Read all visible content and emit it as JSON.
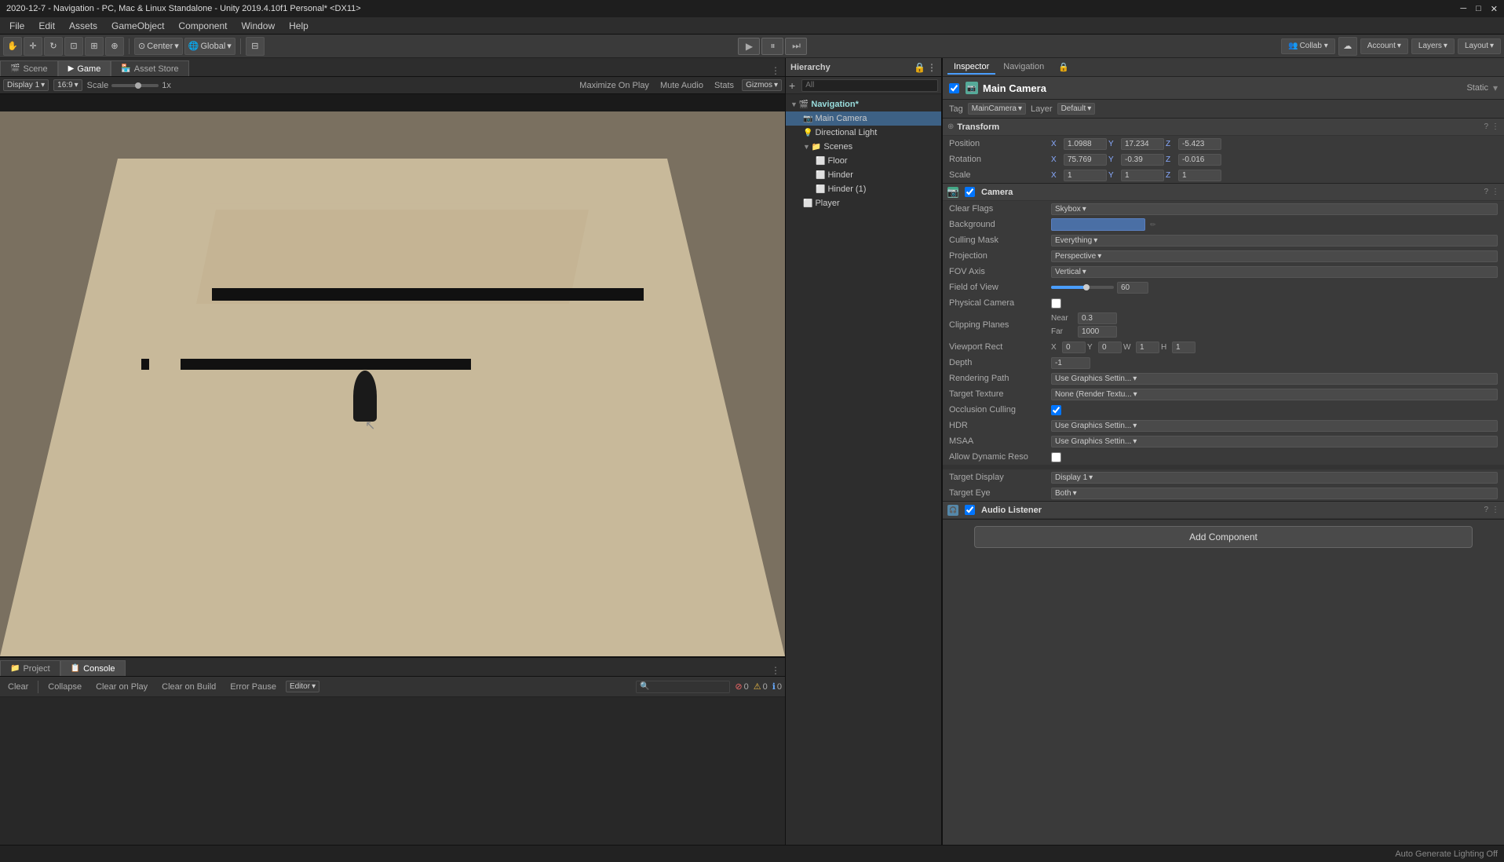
{
  "titlebar": {
    "text": "2020-12-7 - Navigation - PC, Mac & Linux Standalone - Unity 2019.4.10f1 Personal* <DX11>"
  },
  "menubar": {
    "items": [
      "File",
      "Edit",
      "Assets",
      "GameObject",
      "Component",
      "Window",
      "Help"
    ]
  },
  "toolbar": {
    "tools": [
      "⊕",
      "↔",
      "↻",
      "⊡",
      "⊞"
    ],
    "pivot": "Center",
    "space": "Global",
    "play": "▶",
    "pause": "⏸",
    "step": "⏭",
    "collab": "Collab ▾",
    "cloud": "☁",
    "account": "Account",
    "layers": "Layers",
    "layout": "Layout"
  },
  "viewport": {
    "tabs": [
      "Scene",
      "Game",
      "Asset Store"
    ],
    "display": "Display 1",
    "aspect": "16:9",
    "scale_label": "Scale",
    "scale_value": "1x",
    "maximize": "Maximize On Play",
    "mute": "Mute Audio",
    "stats": "Stats",
    "gizmos": "Gizmos"
  },
  "hierarchy": {
    "title": "Hierarchy",
    "search_placeholder": "All",
    "items": [
      {
        "name": "Navigation*",
        "depth": 0,
        "type": "scene",
        "expanded": true
      },
      {
        "name": "Main Camera",
        "depth": 1,
        "type": "camera",
        "selected": true
      },
      {
        "name": "Directional Light",
        "depth": 1,
        "type": "light"
      },
      {
        "name": "Scenes",
        "depth": 1,
        "type": "folder",
        "expanded": true
      },
      {
        "name": "Floor",
        "depth": 2,
        "type": "mesh"
      },
      {
        "name": "Hinder",
        "depth": 2,
        "type": "mesh"
      },
      {
        "name": "Hinder (1)",
        "depth": 2,
        "type": "mesh"
      },
      {
        "name": "Player",
        "depth": 1,
        "type": "mesh"
      }
    ]
  },
  "inspector": {
    "tabs": [
      "Inspector",
      "Navigation"
    ],
    "object": {
      "name": "Main Camera",
      "static": "Static",
      "tag": "MainCamera",
      "layer": "Default"
    },
    "transform": {
      "title": "Transform",
      "position": {
        "x": "1.0988",
        "y": "17.234",
        "z": "-5.423"
      },
      "rotation": {
        "x": "75.769",
        "y": "-0.39",
        "z": "-0.016"
      },
      "scale": {
        "x": "1",
        "y": "1",
        "z": "1"
      }
    },
    "camera": {
      "title": "Camera",
      "clear_flags_label": "Clear Flags",
      "clear_flags_value": "Skybox",
      "background_label": "Background",
      "culling_mask_label": "Culling Mask",
      "culling_mask_value": "Everything",
      "projection_label": "Projection",
      "projection_value": "Perspective",
      "fov_axis_label": "FOV Axis",
      "fov_axis_value": "Vertical",
      "fov_label": "Field of View",
      "fov_value": "60",
      "fov_slider_pct": 55,
      "physical_camera_label": "Physical Camera",
      "clipping_label": "Clipping Planes",
      "near_label": "Near",
      "near_value": "0.3",
      "far_label": "Far",
      "far_value": "1000",
      "viewport_rect_label": "Viewport Rect",
      "vp_x": "0",
      "vp_y": "0",
      "vp_w": "1",
      "vp_h": "1",
      "depth_label": "Depth",
      "depth_value": "-1",
      "rendering_path_label": "Rendering Path",
      "rendering_path_value": "Use Graphics Settin...",
      "target_texture_label": "Target Texture",
      "target_texture_value": "None (Render Textu...",
      "occlusion_label": "Occlusion Culling",
      "hdr_label": "HDR",
      "hdr_value": "Use Graphics Settin...",
      "msaa_label": "MSAA",
      "msaa_value": "Use Graphics Settin...",
      "dynamic_label": "Allow Dynamic Reso",
      "target_display_label": "Target Display",
      "target_display_value": "Display 1",
      "target_eye_label": "Target Eye",
      "target_eye_value": "Both"
    },
    "audio_listener": {
      "title": "Audio Listener"
    },
    "add_component": "Add Component"
  },
  "console": {
    "tabs": [
      "Project",
      "Console"
    ],
    "buttons": [
      "Clear",
      "Collapse",
      "Clear on Play",
      "Clear on Build",
      "Error Pause",
      "Editor"
    ],
    "errors": "0",
    "warnings": "0",
    "info": "0"
  },
  "statusbar": {
    "text": "Auto Generate Lighting Off"
  }
}
